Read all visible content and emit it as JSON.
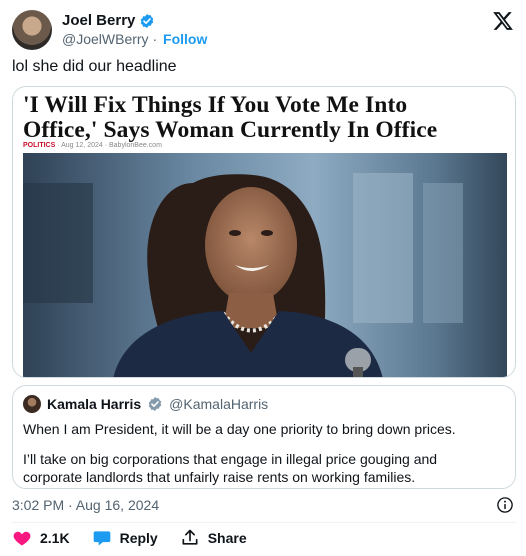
{
  "author": {
    "display_name": "Joel Berry",
    "handle": "@JoelWBerry",
    "separator": "·",
    "follow_label": "Follow"
  },
  "tweet": {
    "text": "lol she did our headline"
  },
  "card": {
    "headline_line1": "'I Will Fix Things If You Vote Me Into",
    "headline_line2": "Office,' Says Woman Currently In Office",
    "category": "POLITICS",
    "meta_rest": " · Aug 12, 2024 · BabylonBee.com"
  },
  "quoted": {
    "display_name": "Kamala Harris",
    "handle": "@KamalaHarris",
    "line1": "When I am President, it will be a day one priority to bring down prices.",
    "line2": "I’ll take on big corporations that engage in illegal price gouging and corporate landlords that unfairly raise rents on working families."
  },
  "timestamp": "3:02 PM · Aug 16, 2024",
  "actions": {
    "like_count": "2.1K",
    "reply_label": "Reply",
    "share_label": "Share"
  },
  "colors": {
    "accent": "#1d9bf0",
    "like": "#f91880",
    "secondary_text": "#536471"
  }
}
